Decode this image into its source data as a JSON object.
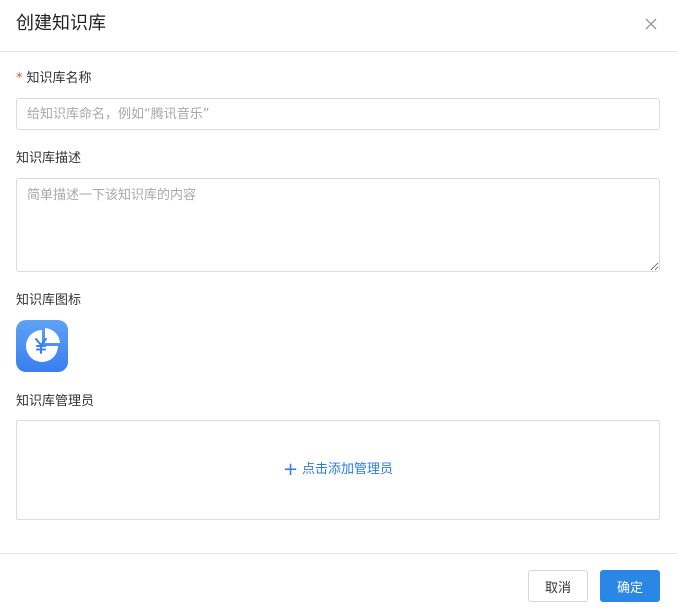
{
  "dialog": {
    "title": "创建知识库",
    "close_icon": "close-icon"
  },
  "form": {
    "name": {
      "required_mark": "*",
      "label": "知识库名称",
      "value": "",
      "placeholder": "给知识库命名，例如“腾讯音乐”"
    },
    "description": {
      "label": "知识库描述",
      "value": "",
      "placeholder": "简单描述一下该知识库的内容"
    },
    "icon": {
      "label": "知识库图标",
      "icon_name": "yuan-pie-chart-icon",
      "accent": "#3a7ef0"
    },
    "admins": {
      "label": "知识库管理员",
      "add_label": "点击添加管理员",
      "add_icon": "plus-icon",
      "link_color": "#2c7be5"
    }
  },
  "footer": {
    "cancel_label": "取消",
    "ok_label": "确定",
    "primary_color": "#2b87e6"
  }
}
